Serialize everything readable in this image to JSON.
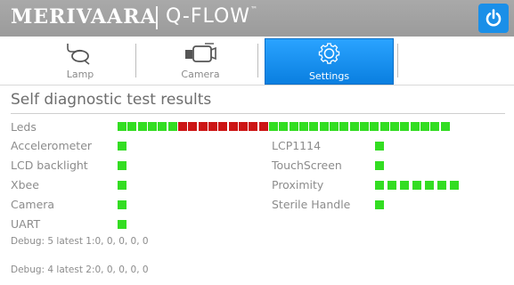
{
  "header": {
    "brand": "MERIVAARA",
    "product": "Q-FLOW",
    "trademark": "™",
    "power_icon": "power-icon"
  },
  "tabs": [
    {
      "label": "Lamp",
      "icon": "lamp-icon",
      "selected": false
    },
    {
      "label": "Camera",
      "icon": "camera-icon",
      "selected": false
    },
    {
      "label": "Settings",
      "icon": "gear-icon",
      "selected": true
    }
  ],
  "section": {
    "title": "Self diagnostic test results"
  },
  "leds": {
    "label": "Leds",
    "states": [
      "ok",
      "ok",
      "ok",
      "ok",
      "ok",
      "ok",
      "fail",
      "fail",
      "fail",
      "fail",
      "fail",
      "fail",
      "fail",
      "fail",
      "fail",
      "ok",
      "ok",
      "ok",
      "ok",
      "ok",
      "ok",
      "ok",
      "ok",
      "ok",
      "ok",
      "ok",
      "ok",
      "ok",
      "ok",
      "ok",
      "ok",
      "ok",
      "ok"
    ]
  },
  "tests_left": [
    {
      "label": "Accelerometer",
      "count": 1
    },
    {
      "label": "LCD backlight",
      "count": 1
    },
    {
      "label": "Xbee",
      "count": 1
    },
    {
      "label": "Camera",
      "count": 1
    },
    {
      "label": "UART",
      "count": 1
    }
  ],
  "tests_right": [
    {
      "label": "LCP1114",
      "count": 1
    },
    {
      "label": "TouchScreen",
      "count": 1
    },
    {
      "label": "Proximity",
      "count": 7
    },
    {
      "label": "Sterile Handle",
      "count": 1
    }
  ],
  "debug": [
    "Debug: 5 latest 1:0, 0, 0, 0, 0",
    "Debug: 4 latest 2:0, 0, 0, 0, 0"
  ],
  "colors": {
    "ok": "#33dd22",
    "fail": "#cc1515",
    "accent": "#1a8fe8",
    "header": "#a3a3a3"
  }
}
